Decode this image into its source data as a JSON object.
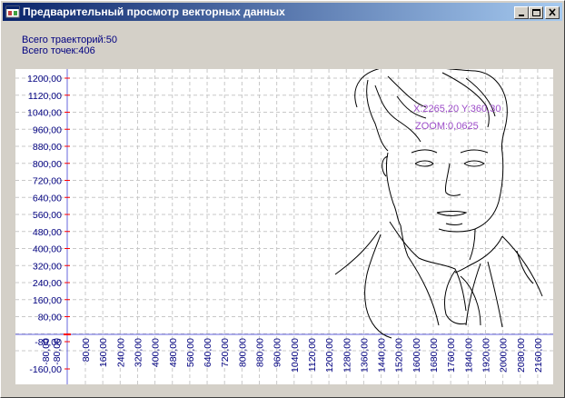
{
  "window": {
    "title": "Предварительный просмотр векторных данных",
    "buttons": [
      "minimize",
      "maximize",
      "close"
    ]
  },
  "info": {
    "trajectories": "Всего траекторий:50",
    "points": "Всего точек:406"
  },
  "plot": {
    "cursor_readout": "X:2265,20 Y:360,30",
    "zoom_readout": "ZOOM:0,0625",
    "y_tick_labels": [
      "1200,00",
      "1120,00",
      "1040,00",
      "960,00",
      "880,00",
      "800,00",
      "720,00",
      "640,00",
      "560,00",
      "480,00",
      "400,00",
      "320,00",
      "240,00",
      "160,00",
      "80,00",
      "-80,00",
      "-160,00"
    ],
    "y_overlap_label": "-80,00",
    "x_tick_labels": [
      "-80,00",
      "80,00",
      "160,00",
      "240,00",
      "320,00",
      "400,00",
      "480,00",
      "560,00",
      "640,00",
      "720,00",
      "800,00",
      "880,00",
      "960,00",
      "1040,00",
      "1120,00",
      "1200,00",
      "1280,00",
      "1360,00",
      "1440,00",
      "1520,00",
      "1600,00",
      "1680,00",
      "1760,00",
      "1840,00",
      "1920,00",
      "2000,00",
      "2080,00",
      "2160,00"
    ],
    "colors": {
      "tick_label": "#000080",
      "axis": "#6464dc",
      "grid": "#c8c8c8",
      "origin": "#ff0000",
      "readout": "#9c4cc8",
      "drawing": "#000000"
    }
  }
}
